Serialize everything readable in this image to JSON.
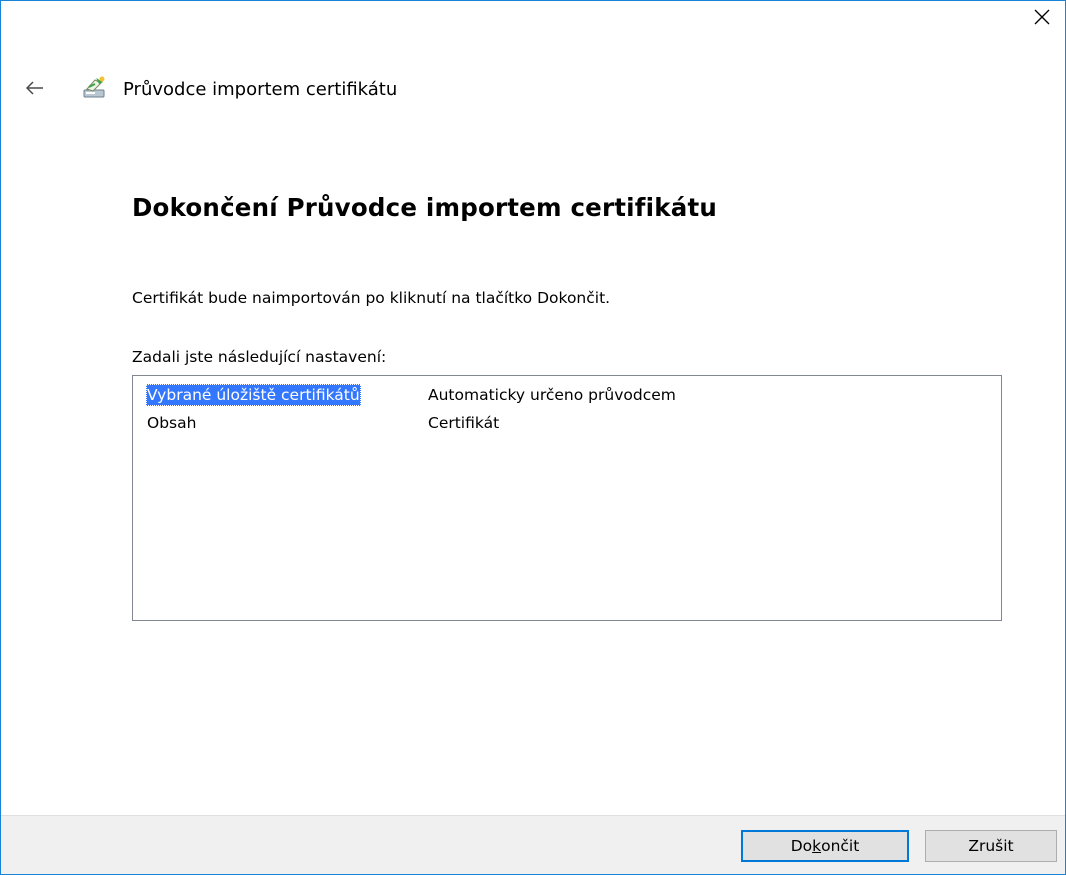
{
  "window": {
    "close_icon": "close-icon",
    "back_icon": "back-arrow-icon",
    "wizard_icon": "certificate-wizard-icon",
    "wizard_title": "Průvodce importem certifikátu"
  },
  "page": {
    "heading": "Dokončení Průvodce importem certifikátu",
    "info": "Certifikát bude naimportován po kliknutí na tlačítko Dokončit.",
    "settings_label": "Zadali jste následující nastavení:"
  },
  "settings": [
    {
      "name": "Vybrané úložiště certifikátů",
      "value": "Automaticky určeno průvodcem",
      "selected": true
    },
    {
      "name": "Obsah",
      "value": "Certifikát",
      "selected": false
    }
  ],
  "footer": {
    "finish_pre": "Do",
    "finish_accel": "k",
    "finish_post": "ončit",
    "cancel_label": "Zrušit"
  },
  "colors": {
    "window_border": "#1883d7",
    "selection": "#3377ff",
    "default_button_border": "#0078d7",
    "footer_bg": "#f0f0f0"
  }
}
